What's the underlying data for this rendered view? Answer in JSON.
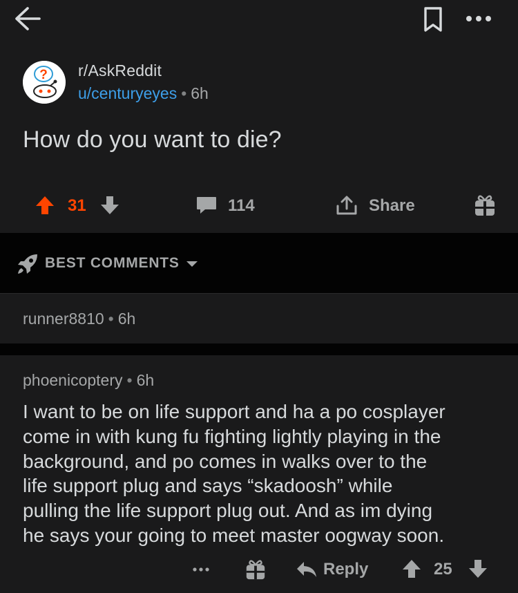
{
  "toolbar": {
    "back_icon": "arrow-left-icon",
    "save_icon": "bookmark-icon",
    "more_icon": "ellipsis-icon"
  },
  "post": {
    "subreddit": "r/AskReddit",
    "author": "u/centuryeyes",
    "separator": "•",
    "age": "6h",
    "title": "How do you want to die?",
    "votes": "31",
    "comments_count": "114",
    "share_label": "Share"
  },
  "sort": {
    "label": "BEST COMMENTS",
    "icon": "rocket-icon"
  },
  "collapsed_comment": {
    "author": "runner8810",
    "separator": "•",
    "age": "6h"
  },
  "comment": {
    "author": "phoenicoptery",
    "separator": "•",
    "age": "6h",
    "body_lines": [
      "I want to be on life support and ha a po cosplayer",
      "come in with kung fu fighting lightly playing in the",
      "background, and po comes in walks over to the",
      "life support plug and says “skadoosh” while",
      "pulling the life support plug out. And as im dying",
      "he says your going to meet master oogway soon."
    ],
    "reply_label": "Reply",
    "score": "25"
  },
  "colors": {
    "background": "#1a1a1b",
    "dark_band": "#030303",
    "upvote_orange": "#ff4500",
    "link_blue": "#3d9ee8",
    "text_primary": "#d7dadc",
    "text_muted": "#a5a7a8"
  }
}
